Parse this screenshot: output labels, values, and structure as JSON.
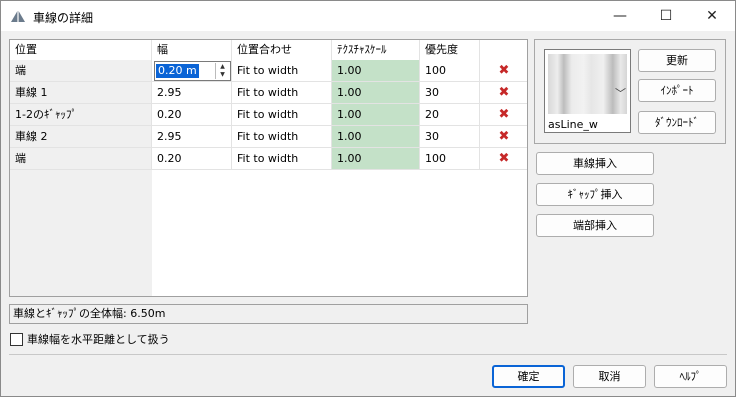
{
  "window": {
    "title": "車線の詳細",
    "controls": {
      "minimize": "—",
      "maximize": "☐",
      "close": "✕"
    }
  },
  "grid": {
    "headers": [
      "位置",
      "幅",
      "位置合わせ",
      "ﾃｸｽﾁｬｽｹｰﾙ",
      "優先度",
      ""
    ],
    "rows": [
      {
        "name": "端",
        "width": "0.20 m",
        "fit": "Fit to width",
        "scale": "1.00",
        "priority": "100"
      },
      {
        "name": "車線 1",
        "width": "2.95",
        "fit": "Fit to width",
        "scale": "1.00",
        "priority": "30"
      },
      {
        "name": "1-2のｷﾞｬｯﾌﾟ",
        "width": "0.20",
        "fit": "Fit to width",
        "scale": "1.00",
        "priority": "20"
      },
      {
        "name": "車線 2",
        "width": "2.95",
        "fit": "Fit to width",
        "scale": "1.00",
        "priority": "30"
      },
      {
        "name": "端",
        "width": "0.20",
        "fit": "Fit to width",
        "scale": "1.00",
        "priority": "100"
      }
    ],
    "delete_icon": "✖"
  },
  "material": {
    "label": "asLine_w",
    "chevron": "﹀"
  },
  "buttons": {
    "update": "更新",
    "import": "ｲﾝﾎﾟｰﾄ",
    "download": "ﾀﾞｳﾝﾛｰﾄﾞ",
    "insert_lane": "車線挿入",
    "insert_gap": "ｷﾞｬｯﾌﾟ挿入",
    "insert_edge": "端部挿入",
    "ok": "確定",
    "cancel": "取消",
    "help": "ﾍﾙﾌﾟ"
  },
  "total_width": "車線とｷﾞｬｯﾌﾟの全体幅: 6.50m",
  "checkbox": {
    "label": "車線幅を水平距離として扱う",
    "checked": false
  },
  "colors": {
    "scale_bg": "#c4e1c8",
    "selection": "#0a64d6",
    "delete": "#c62828"
  }
}
